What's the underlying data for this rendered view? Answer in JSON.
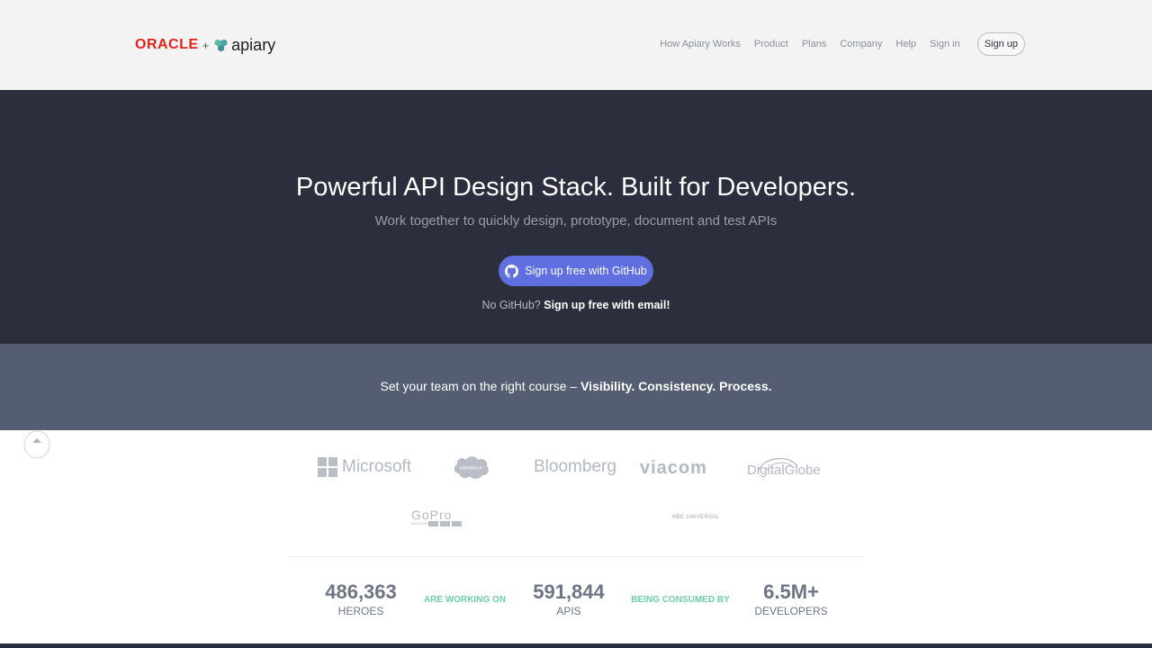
{
  "header": {
    "logo_oracle": "ORACLE",
    "logo_plus": "+",
    "logo_apiary": "apiary",
    "nav": [
      "How Apiary Works",
      "Product",
      "Plans",
      "Company",
      "Help",
      "Sign in"
    ],
    "signup_label": "Sign up"
  },
  "hero": {
    "title": "Powerful API Design Stack. Built for Developers.",
    "subtitle": "Work together to quickly design, prototype, document and test APIs",
    "github_button": "Sign up free with GitHub",
    "no_github": "No GitHub?",
    "email_signup": "Sign up free with email!"
  },
  "band": {
    "lead": "Set your team on the right course –",
    "bold": "Visibility. Consistency. Process."
  },
  "customers": {
    "microsoft": "Microsoft",
    "salesforce": "salesforce",
    "bloomberg": "Bloomberg",
    "viacom": "viacom",
    "digitalglobe": "DigitalGlobe",
    "gopro": "GoPro",
    "gopro_tag": "Be a HERO.",
    "nbc": "NBC UNIVERSAL"
  },
  "stats": {
    "heroes_value": "486,363",
    "heroes_label": "HEROES",
    "connector_1": "ARE WORKING ON",
    "apis_value": "591,844",
    "apis_label": "APIS",
    "connector_2": "BEING CONSUMED BY",
    "developers_value": "6.5M+",
    "developers_label": "DEVELOPERS"
  },
  "colors": {
    "hero_bg": "#2b2e3d",
    "band_bg": "#545d72",
    "github_button": "#5f6fe0",
    "oracle_red": "#e2231a",
    "stat_accent": "#6ecfa6"
  }
}
